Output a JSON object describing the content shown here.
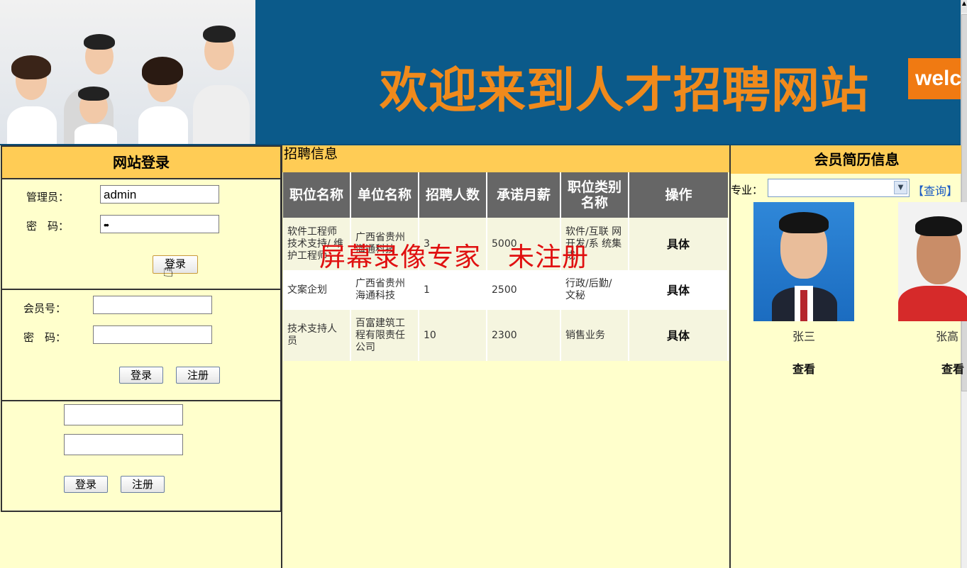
{
  "banner": {
    "title": "欢迎来到人才招聘网站",
    "badge": "welco"
  },
  "admin_login": {
    "heading": "网站登录",
    "username_label": "管理员：",
    "username_value": "admin",
    "password_label": "密　码：",
    "password_value": "••",
    "login_label": "登录"
  },
  "member_login": {
    "member_label": "会员号：",
    "password_label": "密　码：",
    "login_label": "登录",
    "register_label": "注册"
  },
  "other_login": {
    "login_label": "登录",
    "register_label": "注册"
  },
  "jobs": {
    "heading": "招聘信息",
    "columns": [
      "职位名称",
      "单位名称",
      "招聘人数",
      "承诺月薪",
      "职位类别名称",
      "操作"
    ],
    "rows": [
      {
        "position": "软件工程师 技术支持/ 维护工程师",
        "company": "广西省贵州 海通科技",
        "count": "3",
        "salary": "5000",
        "category": "软件/互联 网开发/系 统集成",
        "action": "具体"
      },
      {
        "position": "文案企划",
        "company": "广西省贵州 海通科技",
        "count": "1",
        "salary": "2500",
        "category": "行政/后勤/ 文秘",
        "action": "具体"
      },
      {
        "position": "技术支持人 员",
        "company": "百富建筑工 程有限责任 公司",
        "count": "10",
        "salary": "2300",
        "category": "销售业务",
        "action": "具体"
      }
    ]
  },
  "watermark": "屏幕录像专家　未注册",
  "resumes": {
    "heading": "会员简历信息",
    "specialty_label": "专业：",
    "query_label": "【查询】",
    "members": [
      {
        "name": "张三",
        "view": "查看"
      },
      {
        "name": "张高",
        "view": "查看"
      }
    ]
  },
  "colors": {
    "header_bg": "#0b5a8a",
    "title": "#f08a1c",
    "panel_head": "#ffcc55",
    "page_bg": "#ffffcc",
    "table_head": "#666666"
  }
}
